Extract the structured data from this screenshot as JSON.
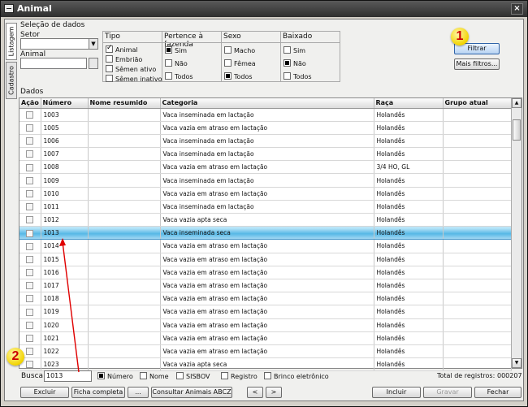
{
  "window": {
    "title": "Animal",
    "close_glyph": "×"
  },
  "sidetabs": {
    "listagem": "Listagem",
    "cadastro": "Cadastro"
  },
  "selection": {
    "title": "Seleção de dados",
    "setor_label": "Setor",
    "animal_label": "Animal",
    "tipo": {
      "title": "Tipo",
      "options": [
        "Animal",
        "Embrião",
        "Sêmen ativo",
        "Sêmen inativo"
      ]
    },
    "pertence": {
      "title": "Pertence à fazenda",
      "options": [
        "Sim",
        "Não",
        "Todos"
      ]
    },
    "sexo": {
      "title": "Sexo",
      "options": [
        "Macho",
        "Fêmea",
        "Todos"
      ]
    },
    "baixado": {
      "title": "Baixado",
      "options": [
        "Sim",
        "Não",
        "Todos"
      ]
    },
    "filtrar_button": "Filtrar",
    "mais_filtros_button": "Mais filtros..."
  },
  "dados": {
    "title": "Dados",
    "columns": [
      "Ação",
      "Número",
      "Nome resumido",
      "Categoria",
      "Raça",
      "Grupo atual"
    ],
    "rows": [
      {
        "numero": "1003",
        "nome": "",
        "categoria": "Vaca inseminada em lactação",
        "raca": "Holandês",
        "grupo": ""
      },
      {
        "numero": "1005",
        "nome": "",
        "categoria": "Vaca vazia em atraso em lactação",
        "raca": "Holandês",
        "grupo": ""
      },
      {
        "numero": "1006",
        "nome": "",
        "categoria": "Vaca inseminada em lactação",
        "raca": "Holandês",
        "grupo": ""
      },
      {
        "numero": "1007",
        "nome": "",
        "categoria": "Vaca inseminada em lactação",
        "raca": "Holandês",
        "grupo": ""
      },
      {
        "numero": "1008",
        "nome": "",
        "categoria": "Vaca vazia em atraso em lactação",
        "raca": "3/4 HO, GL",
        "grupo": ""
      },
      {
        "numero": "1009",
        "nome": "",
        "categoria": "Vaca inseminada em lactação",
        "raca": "Holandês",
        "grupo": ""
      },
      {
        "numero": "1010",
        "nome": "",
        "categoria": "Vaca vazia em atraso em lactação",
        "raca": "Holandês",
        "grupo": ""
      },
      {
        "numero": "1011",
        "nome": "",
        "categoria": "Vaca inseminada em lactação",
        "raca": "Holandês",
        "grupo": ""
      },
      {
        "numero": "1012",
        "nome": "",
        "categoria": "Vaca vazia apta seca",
        "raca": "Holandês",
        "grupo": ""
      },
      {
        "numero": "1013",
        "nome": "",
        "categoria": "Vaca inseminada seca",
        "raca": "Holandês",
        "grupo": ""
      },
      {
        "numero": "1014",
        "nome": "",
        "categoria": "Vaca vazia em atraso em lactação",
        "raca": "Holandês",
        "grupo": ""
      },
      {
        "numero": "1015",
        "nome": "",
        "categoria": "Vaca vazia em atraso em lactação",
        "raca": "Holandês",
        "grupo": ""
      },
      {
        "numero": "1016",
        "nome": "",
        "categoria": "Vaca vazia em atraso em lactação",
        "raca": "Holandês",
        "grupo": ""
      },
      {
        "numero": "1017",
        "nome": "",
        "categoria": "Vaca vazia em atraso em lactação",
        "raca": "Holandês",
        "grupo": ""
      },
      {
        "numero": "1018",
        "nome": "",
        "categoria": "Vaca vazia em atraso em lactação",
        "raca": "Holandês",
        "grupo": ""
      },
      {
        "numero": "1019",
        "nome": "",
        "categoria": "Vaca vazia em atraso em lactação",
        "raca": "Holandês",
        "grupo": ""
      },
      {
        "numero": "1020",
        "nome": "",
        "categoria": "Vaca vazia em atraso em lactação",
        "raca": "Holandês",
        "grupo": ""
      },
      {
        "numero": "1021",
        "nome": "",
        "categoria": "Vaca vazia em atraso em lactação",
        "raca": "Holandês",
        "grupo": ""
      },
      {
        "numero": "1022",
        "nome": "",
        "categoria": "Vaca vazia em atraso em lactação",
        "raca": "Holandês",
        "grupo": ""
      },
      {
        "numero": "1023",
        "nome": "",
        "categoria": "Vaca vazia apta seca",
        "raca": "Holandês",
        "grupo": ""
      }
    ]
  },
  "busca": {
    "label": "Busca",
    "value": "1013",
    "options": [
      "Número",
      "Nome",
      "SISBOV",
      "Registro",
      "Brinco eletrônico"
    ],
    "total_label": "Total de registros:",
    "total_value": "000207"
  },
  "actions": {
    "excluir": "Excluir",
    "ficha": "Ficha completa",
    "dots": "...",
    "consultar": "Consultar Animais ABCZ",
    "prev": "<",
    "next": ">",
    "incluir": "Incluir",
    "gravar": "Gravar",
    "fechar": "Fechar"
  },
  "annotations": {
    "badge1": "1",
    "badge2": "2"
  },
  "colors": {
    "selected_row": "#57b8e6",
    "annotation_arrow": "#e00000",
    "badge_fill": "#f2d400"
  }
}
